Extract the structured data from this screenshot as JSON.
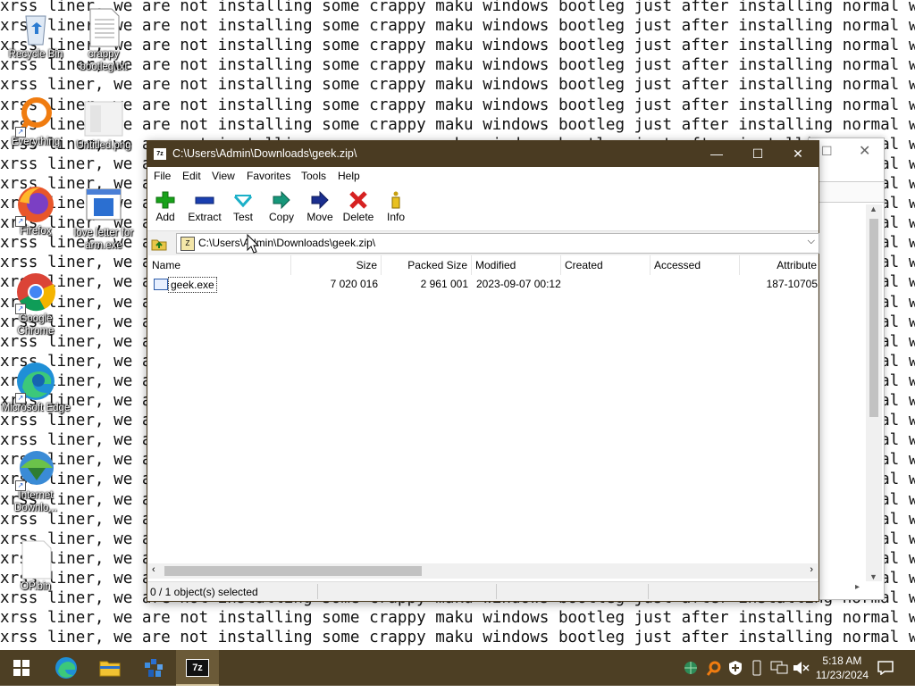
{
  "wallpaper": {
    "full_line": "xrss liner, we are not installing some crappy maku windows bootleg just after installing normal windows",
    "line_count": 33
  },
  "desktop_icons": [
    {
      "label": "Recycle Bin",
      "icon": "recycle-bin-icon"
    },
    {
      "label": "crappy bootleg.txt",
      "icon": "text-file-icon"
    },
    {
      "label": "Everything",
      "icon": "everything-search-icon"
    },
    {
      "label": "Untitled.png",
      "icon": "image-file-icon"
    },
    {
      "label": "Firefox",
      "icon": "firefox-icon"
    },
    {
      "label": "love letter for arm.exe",
      "icon": "exe-file-icon"
    },
    {
      "label": "Google Chrome",
      "icon": "chrome-icon"
    },
    {
      "label": "Microsoft Edge",
      "icon": "edge-icon"
    },
    {
      "label": "Internet Downlo...",
      "icon": "internet-download-manager-icon"
    },
    {
      "label": "OP.bin",
      "icon": "blank-file-icon"
    }
  ],
  "window": {
    "title": "C:\\Users\\Admin\\Downloads\\geek.zip\\",
    "app_icon_text": "7z",
    "controls": {
      "minimize": "—",
      "maximize": "☐",
      "close": "✕"
    },
    "menu": [
      "File",
      "Edit",
      "View",
      "Favorites",
      "Tools",
      "Help"
    ],
    "toolbar": [
      {
        "label": "Add",
        "icon": "add-icon"
      },
      {
        "label": "Extract",
        "icon": "extract-icon"
      },
      {
        "label": "Test",
        "icon": "test-icon"
      },
      {
        "label": "Copy",
        "icon": "copy-icon"
      },
      {
        "label": "Move",
        "icon": "move-icon"
      },
      {
        "label": "Delete",
        "icon": "delete-icon"
      },
      {
        "label": "Info",
        "icon": "info-icon"
      }
    ],
    "address": "C:\\Users\\Admin\\Downloads\\geek.zip\\",
    "columns": [
      "Name",
      "Size",
      "Packed Size",
      "Modified",
      "Created",
      "Accessed",
      "Attribute"
    ],
    "rows": [
      {
        "name": "geek.exe",
        "size": "7 020 016",
        "packed_size": "2 961 001",
        "modified": "2023-09-07 00:12",
        "created": "",
        "accessed": "",
        "attributes": "187-10705"
      }
    ],
    "status": "0 / 1 object(s) selected"
  },
  "taskbar": {
    "items": [
      {
        "name": "start-button",
        "icon": "windows-logo-icon"
      },
      {
        "name": "edge-taskbar",
        "icon": "edge-icon"
      },
      {
        "name": "file-explorer-taskbar",
        "icon": "folder-icon"
      },
      {
        "name": "installer-taskbar",
        "icon": "installer-icon"
      },
      {
        "name": "7zip-taskbar",
        "icon": "7zip-icon",
        "label": "7z"
      }
    ],
    "time": "5:18 AM",
    "date": "11/23/2024"
  },
  "colors": {
    "titlebar": "#4a3b22",
    "taskbar": "#4d3f24",
    "add_green": "#18a21a",
    "delete_red": "#d62121",
    "extract_blue": "#1a3fb0"
  }
}
